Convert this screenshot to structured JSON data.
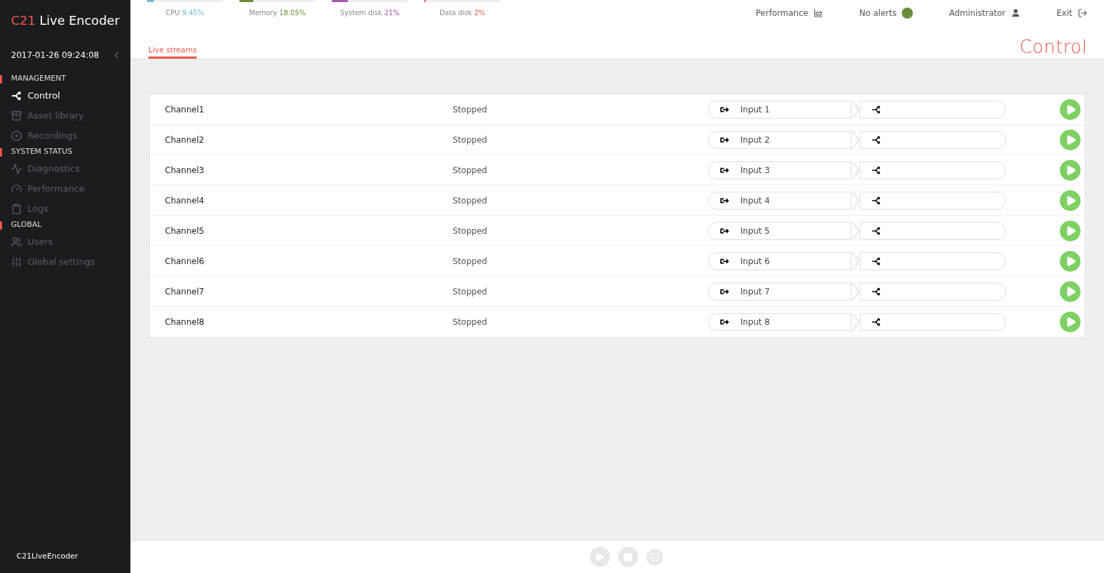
{
  "sidebar": {
    "brand": "C21",
    "title": "Live Encoder",
    "datetime": "2017-01-26 09:24:08",
    "sections": [
      {
        "title": "MANAGEMENT",
        "items": [
          {
            "label": "Control",
            "kind": "control",
            "selected": true
          },
          {
            "label": "Asset library",
            "kind": "archive",
            "selected": false
          },
          {
            "label": "Recordings",
            "kind": "record",
            "selected": false
          }
        ]
      },
      {
        "title": "SYSTEM STATUS",
        "items": [
          {
            "label": "Diagnostics",
            "kind": "pulse",
            "selected": false
          },
          {
            "label": "Performance",
            "kind": "gauge",
            "selected": false
          },
          {
            "label": "Logs",
            "kind": "clipboard",
            "selected": false
          }
        ]
      },
      {
        "title": "GLOBAL",
        "items": [
          {
            "label": "Users",
            "kind": "users",
            "selected": false
          },
          {
            "label": "Global settings",
            "kind": "sliders",
            "selected": false
          }
        ]
      }
    ],
    "footer": "C21LiveEncoder"
  },
  "meters": [
    {
      "label": "CPU",
      "value": "9.45%",
      "level": 0.0945,
      "color": "#6fb8d0"
    },
    {
      "label": "Memory",
      "value": "18.05%",
      "level": 0.1805,
      "color": "#6b8e3a"
    },
    {
      "label": "System disk",
      "value": "21%",
      "level": 0.21,
      "color": "#a855b5"
    },
    {
      "label": "Data disk",
      "value": "2%",
      "level": 0.02,
      "color": "#f0564a"
    }
  ],
  "header_links": [
    {
      "label": "Performance",
      "kind": "chart"
    },
    {
      "label": "No alerts",
      "kind": "status",
      "color": "#6b8e3a"
    },
    {
      "label": "Administrator",
      "kind": "user"
    },
    {
      "label": "Exit",
      "kind": "exit"
    }
  ],
  "tabs": [
    {
      "label": "Live streams",
      "selected": true
    }
  ],
  "page_title": "Control",
  "channels": [
    {
      "name": "Channel1",
      "status": "Stopped",
      "input": "Input 1"
    },
    {
      "name": "Channel2",
      "status": "Stopped",
      "input": "Input 2"
    },
    {
      "name": "Channel3",
      "status": "Stopped",
      "input": "Input 3"
    },
    {
      "name": "Channel4",
      "status": "Stopped",
      "input": "Input 4"
    },
    {
      "name": "Channel5",
      "status": "Stopped",
      "input": "Input 5"
    },
    {
      "name": "Channel6",
      "status": "Stopped",
      "input": "Input 6"
    },
    {
      "name": "Channel7",
      "status": "Stopped",
      "input": "Input 7"
    },
    {
      "name": "Channel8",
      "status": "Stopped",
      "input": "Input 8"
    }
  ],
  "player": {
    "disabled": true
  }
}
